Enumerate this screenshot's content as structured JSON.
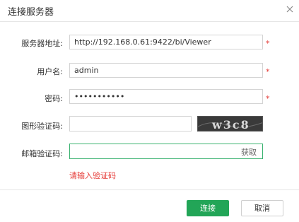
{
  "dialog": {
    "title": "连接服务器"
  },
  "form": {
    "server": {
      "label": "服务器地址:",
      "value": "http://192.168.0.61:9422/bi/Viewer",
      "required_mark": "*"
    },
    "username": {
      "label": "用户名:",
      "value": "admin",
      "required_mark": "*"
    },
    "password": {
      "label": "密码:",
      "value": "•••••••••••",
      "required_mark": "*"
    },
    "captcha": {
      "label": "图形验证码:",
      "value": "",
      "image_text": "w3c8"
    },
    "email_code": {
      "label": "邮箱验证码:",
      "value": "",
      "get_code_label": "获取",
      "error": "请输入验证码"
    }
  },
  "footer": {
    "connect_label": "连接",
    "cancel_label": "取消"
  },
  "colors": {
    "primary": "#22a557",
    "error": "#e53935",
    "focus_border": "#3cb371"
  }
}
